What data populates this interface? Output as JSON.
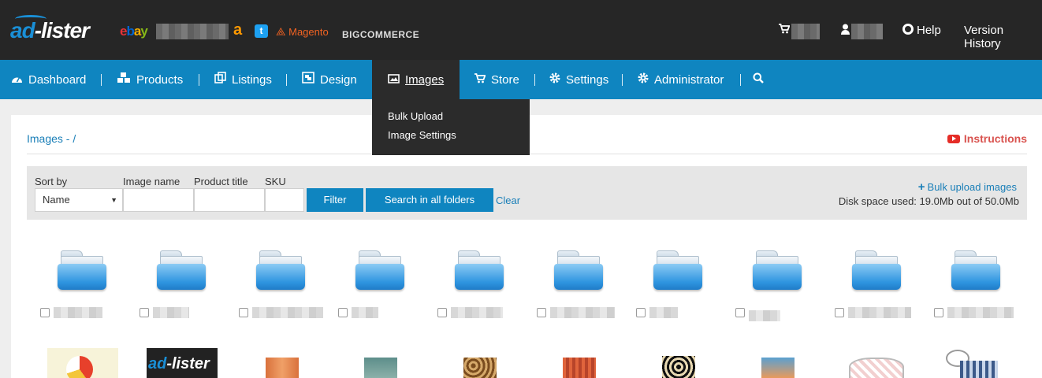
{
  "topbar": {
    "logo": {
      "part1": "ad",
      "part2": "-lister"
    },
    "marketplaces": {
      "ebay": {
        "e": "e",
        "b": "b",
        "a": "a",
        "y": "y"
      },
      "amazon": "a",
      "twitter": "t",
      "magento": "Magento",
      "bigcommerce": "BIGCOMMERCE"
    },
    "cart_icon": "cart-icon",
    "user_icon": "user-icon",
    "help": "Help",
    "version_history": "Version History"
  },
  "nav": {
    "dashboard": "Dashboard",
    "products": "Products",
    "listings": "Listings",
    "design": "Design",
    "images": "Images",
    "store": "Store",
    "settings": "Settings",
    "administrator": "Administrator"
  },
  "dropdown": {
    "items": [
      "Bulk Upload",
      "Image Settings"
    ]
  },
  "main": {
    "breadcrumb": "Images - /",
    "instructions": "Instructions",
    "filter": {
      "sort_by_label": "Sort by",
      "sort_by_value": "Name",
      "image_name_label": "Image name",
      "product_title_label": "Product title",
      "sku_label": "SKU",
      "filter_button": "Filter",
      "search_all_button": "Search in all folders",
      "clear_link": "Clear",
      "bulk_upload": "Bulk upload images",
      "disk_space": "Disk space used: 19.0Mb out of 50.0Mb"
    },
    "thumb_logo": {
      "part1": "ad",
      "part2": "-lister"
    }
  }
}
